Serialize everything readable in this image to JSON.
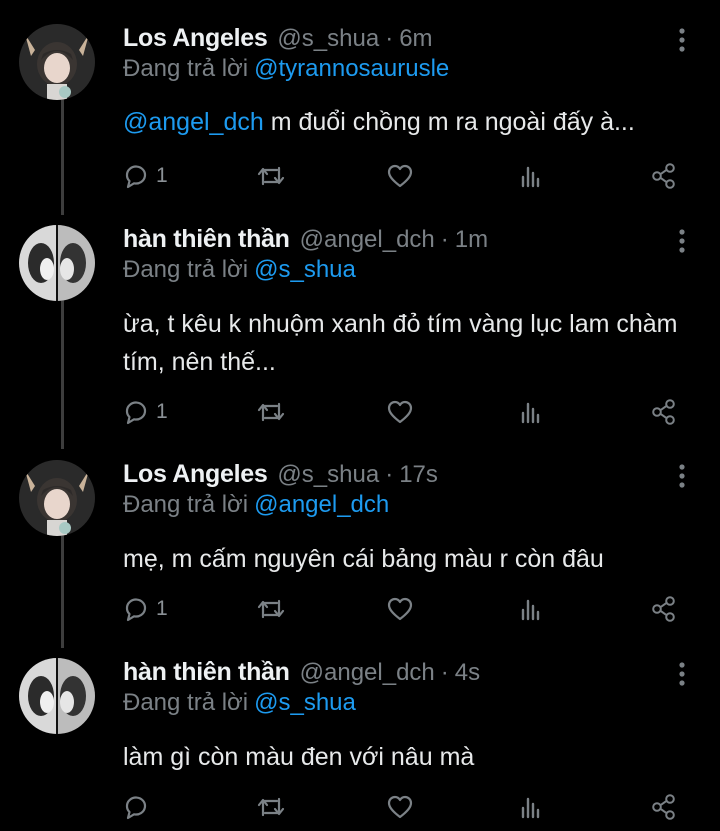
{
  "colors": {
    "background": "#000000",
    "name": "#eef1f3",
    "muted": "#7b8186",
    "link": "#1d9bf0",
    "text": "#e7e9ea",
    "thread_line": "#3d3d3d"
  },
  "tweets": [
    {
      "display_name": "Los Angeles",
      "handle": "@s_shua",
      "separator": "·",
      "time": "6m",
      "reply_prefix": "Đang trả lời",
      "reply_to": "@tyrannosaurusle",
      "body_mention": "@angel_dch",
      "body_text": " m đuổi chồng m ra ngoài đấy à...",
      "reply_count": "1",
      "avatar": "avatar-deer-ears"
    },
    {
      "display_name": "hàn thiên thần",
      "handle": "@angel_dch",
      "separator": "·",
      "time": "1m",
      "reply_prefix": "Đang trả lời",
      "reply_to": "@s_shua",
      "body_mention": "",
      "body_text": "ừa, t kêu k nhuộm xanh đỏ tím vàng lục lam chàm tím, nên thế...",
      "reply_count": "1",
      "avatar": "avatar-mirror-bw"
    },
    {
      "display_name": "Los Angeles",
      "handle": "@s_shua",
      "separator": "·",
      "time": "17s",
      "reply_prefix": "Đang trả lời",
      "reply_to": "@angel_dch",
      "body_mention": "",
      "body_text": "mẹ, m cấm nguyên cái bảng màu r còn đâu",
      "reply_count": "1",
      "avatar": "avatar-deer-ears"
    },
    {
      "display_name": "hàn thiên thần",
      "handle": "@angel_dch",
      "separator": "·",
      "time": "4s",
      "reply_prefix": "Đang trả lời",
      "reply_to": "@s_shua",
      "body_mention": "",
      "body_text": "làm gì còn màu đen với nâu mà",
      "reply_count": "",
      "avatar": "avatar-mirror-bw"
    }
  ],
  "icons": {
    "reply": "reply-icon",
    "retweet": "retweet-icon",
    "like": "heart-icon",
    "views": "analytics-icon",
    "share": "share-icon",
    "more": "more-vertical-icon"
  }
}
